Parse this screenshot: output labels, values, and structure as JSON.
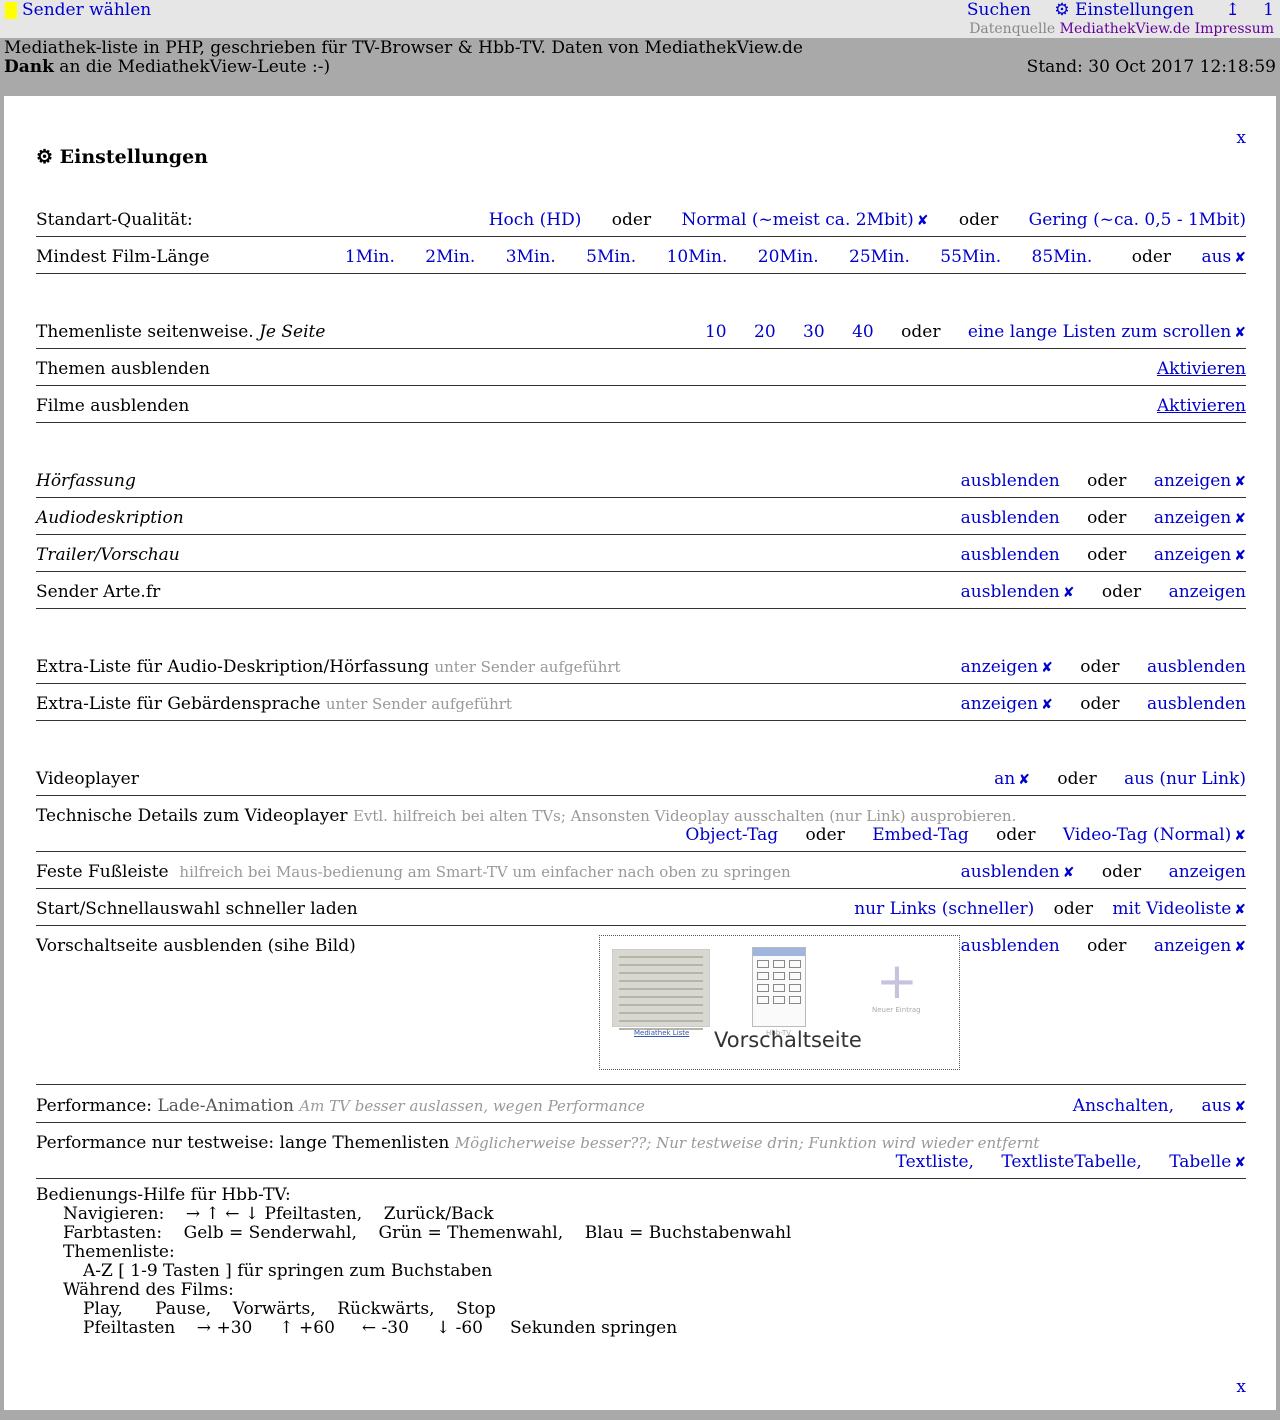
{
  "topbar": {
    "sender_waehlen": "Sender wählen",
    "suchen": "Suchen",
    "einstellungen": "⚙ Einstellungen",
    "up_icon": "↥",
    "num": "1",
    "datenquelle_label": "Datenquelle",
    "mediathekview": "MediathekView.de",
    "impressum": "Impressum"
  },
  "info": {
    "line1": "Mediathek-liste in PHP,  geschrieben für TV-Browser & Hbb-TV. Daten von MediathekView.de",
    "dank": "Dank",
    "line2_rest": " an die MediathekView-Leute :-)",
    "stand": "Stand: 30 Oct 2017 12:18:59"
  },
  "panel": {
    "close": "x",
    "title": "⚙ Einstellungen"
  },
  "oder": "oder",
  "check": "✘",
  "settings": {
    "qualitaet": {
      "label": "Standart-Qualität:",
      "hoch": "Hoch (HD)",
      "normal": "Normal (~meist ca. 2Mbit)",
      "gering": "Gering (~ca. 0,5 - 1Mbit)"
    },
    "filmlaenge": {
      "label": "Mindest Film-Länge",
      "options": [
        "1Min.",
        "2Min.",
        "3Min.",
        "5Min.",
        "10Min.",
        "20Min.",
        "25Min.",
        "55Min.",
        "85Min."
      ],
      "aus": "aus"
    },
    "themenliste": {
      "label": "Themenliste seitenweise.",
      "label_it": "Je Seite",
      "options": [
        "10",
        "20",
        "30",
        "40"
      ],
      "lang": "eine lange Listen zum scrollen"
    },
    "themen_ausblenden": {
      "label": "Themen ausblenden",
      "action": "Aktivieren"
    },
    "filme_ausblenden": {
      "label": "Filme ausblenden",
      "action": "Aktivieren"
    },
    "hoerfassung": {
      "label": "Hörfassung"
    },
    "audiodeskription": {
      "label": "Audiodeskription"
    },
    "trailer": {
      "label": "Trailer/Vorschau"
    },
    "arte": {
      "label": "Sender Arte.fr"
    },
    "ausblenden": "ausblenden",
    "anzeigen": "anzeigen",
    "extra_audio": {
      "label": "Extra-Liste für Audio-Deskription/Hörfassung",
      "hint": "unter Sender aufgeführt"
    },
    "extra_gebaerden": {
      "label": "Extra-Liste für Gebärdensprache",
      "hint": "unter Sender aufgeführt"
    },
    "videoplayer": {
      "label": "Videoplayer",
      "an": "an",
      "aus_link": "aus (nur Link)"
    },
    "technische": {
      "label": "Technische Details zum Videoplayer",
      "hint": "Evtl. hilfreich bei alten TVs; Ansonsten Videoplay ausschalten (nur Link) ausprobieren.",
      "object": "Object-Tag",
      "embed": "Embed-Tag",
      "video": "Video-Tag (Normal)"
    },
    "fussleiste": {
      "label": "Feste Fußleiste",
      "hint": "hilfreich bei Maus-bedienung am Smart-TV um einfacher nach oben zu springen"
    },
    "start": {
      "label": "Start/Schnellauswahl schneller laden",
      "nur_links": "nur Links (schneller)",
      "mit_video": "mit Videoliste"
    },
    "vorschalt": {
      "label": "Vorschaltseite ausblenden (sihe Bild)",
      "image_title": "Vorschaltseite",
      "thumb_mediathek": "Mediathek Liste",
      "thumb_hbbtv": "Hbb-TV",
      "thumb_neu": "Neuer Eintrag"
    },
    "performance": {
      "label": "Performance:",
      "label2": "Lade-Animation",
      "hint": "Am TV besser auslassen, wegen Performance",
      "an": "Anschalten,",
      "aus": "aus"
    },
    "perf_test": {
      "label": "Performance nur testweise: lange Themenlisten",
      "hint": "Möglicherweise besser??; Nur testweise drin; Funktion wird wieder entfernt",
      "textliste": "Textliste,",
      "textlistetabelle": "TextlisteTabelle,",
      "tabelle": "Tabelle"
    }
  },
  "help": {
    "title": "Bedienungs-Hilfe für Hbb-TV:",
    "navigieren": "Navigieren:    → ↑ ← ↓ Pfeiltasten,    Zurück/Back",
    "farbtasten": "Farbtasten:    Gelb = Senderwahl,    Grün = Themenwahl,    Blau = Buchstabenwahl",
    "themenliste": "Themenliste:",
    "az": "A-Z [ 1-9 Tasten ] für springen zum Buchstaben",
    "waehrend": "Während des Films:",
    "play": "Play,      Pause,    Vorwärts,    Rückwärts,    Stop",
    "pfeil": "Pfeiltasten    → +30     ↑ +60     ← -30     ↓ -60     Sekunden springen"
  }
}
